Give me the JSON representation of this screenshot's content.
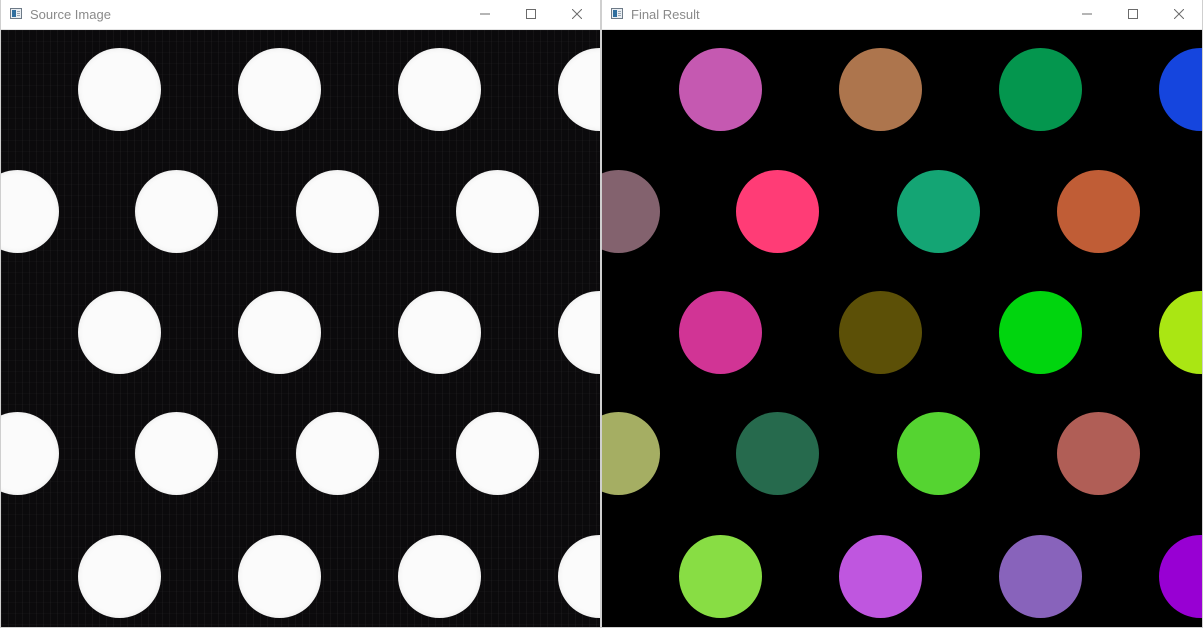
{
  "windows": [
    {
      "title": "Source Image",
      "kind": "source",
      "dot_color": "#fbfbfb"
    },
    {
      "title": "Final Result",
      "kind": "result",
      "dot_colors": [
        "#c559b1",
        "#ad754d",
        "#04964e",
        "#1545de",
        "#83626e",
        "#ff3c76",
        "#14a574",
        "#c05d36",
        "#d13495",
        "#5c5007",
        "#00d50e",
        "#aae613",
        "#a5ae63",
        "#266a4d",
        "#55d431",
        "#b05e56",
        "#88dd44",
        "#bf56df",
        "#8863bb",
        "#9800d3"
      ]
    }
  ],
  "controls": {
    "minimize_icon": "minimize-icon",
    "maximize_icon": "maximize-icon",
    "close_icon": "close-icon"
  }
}
